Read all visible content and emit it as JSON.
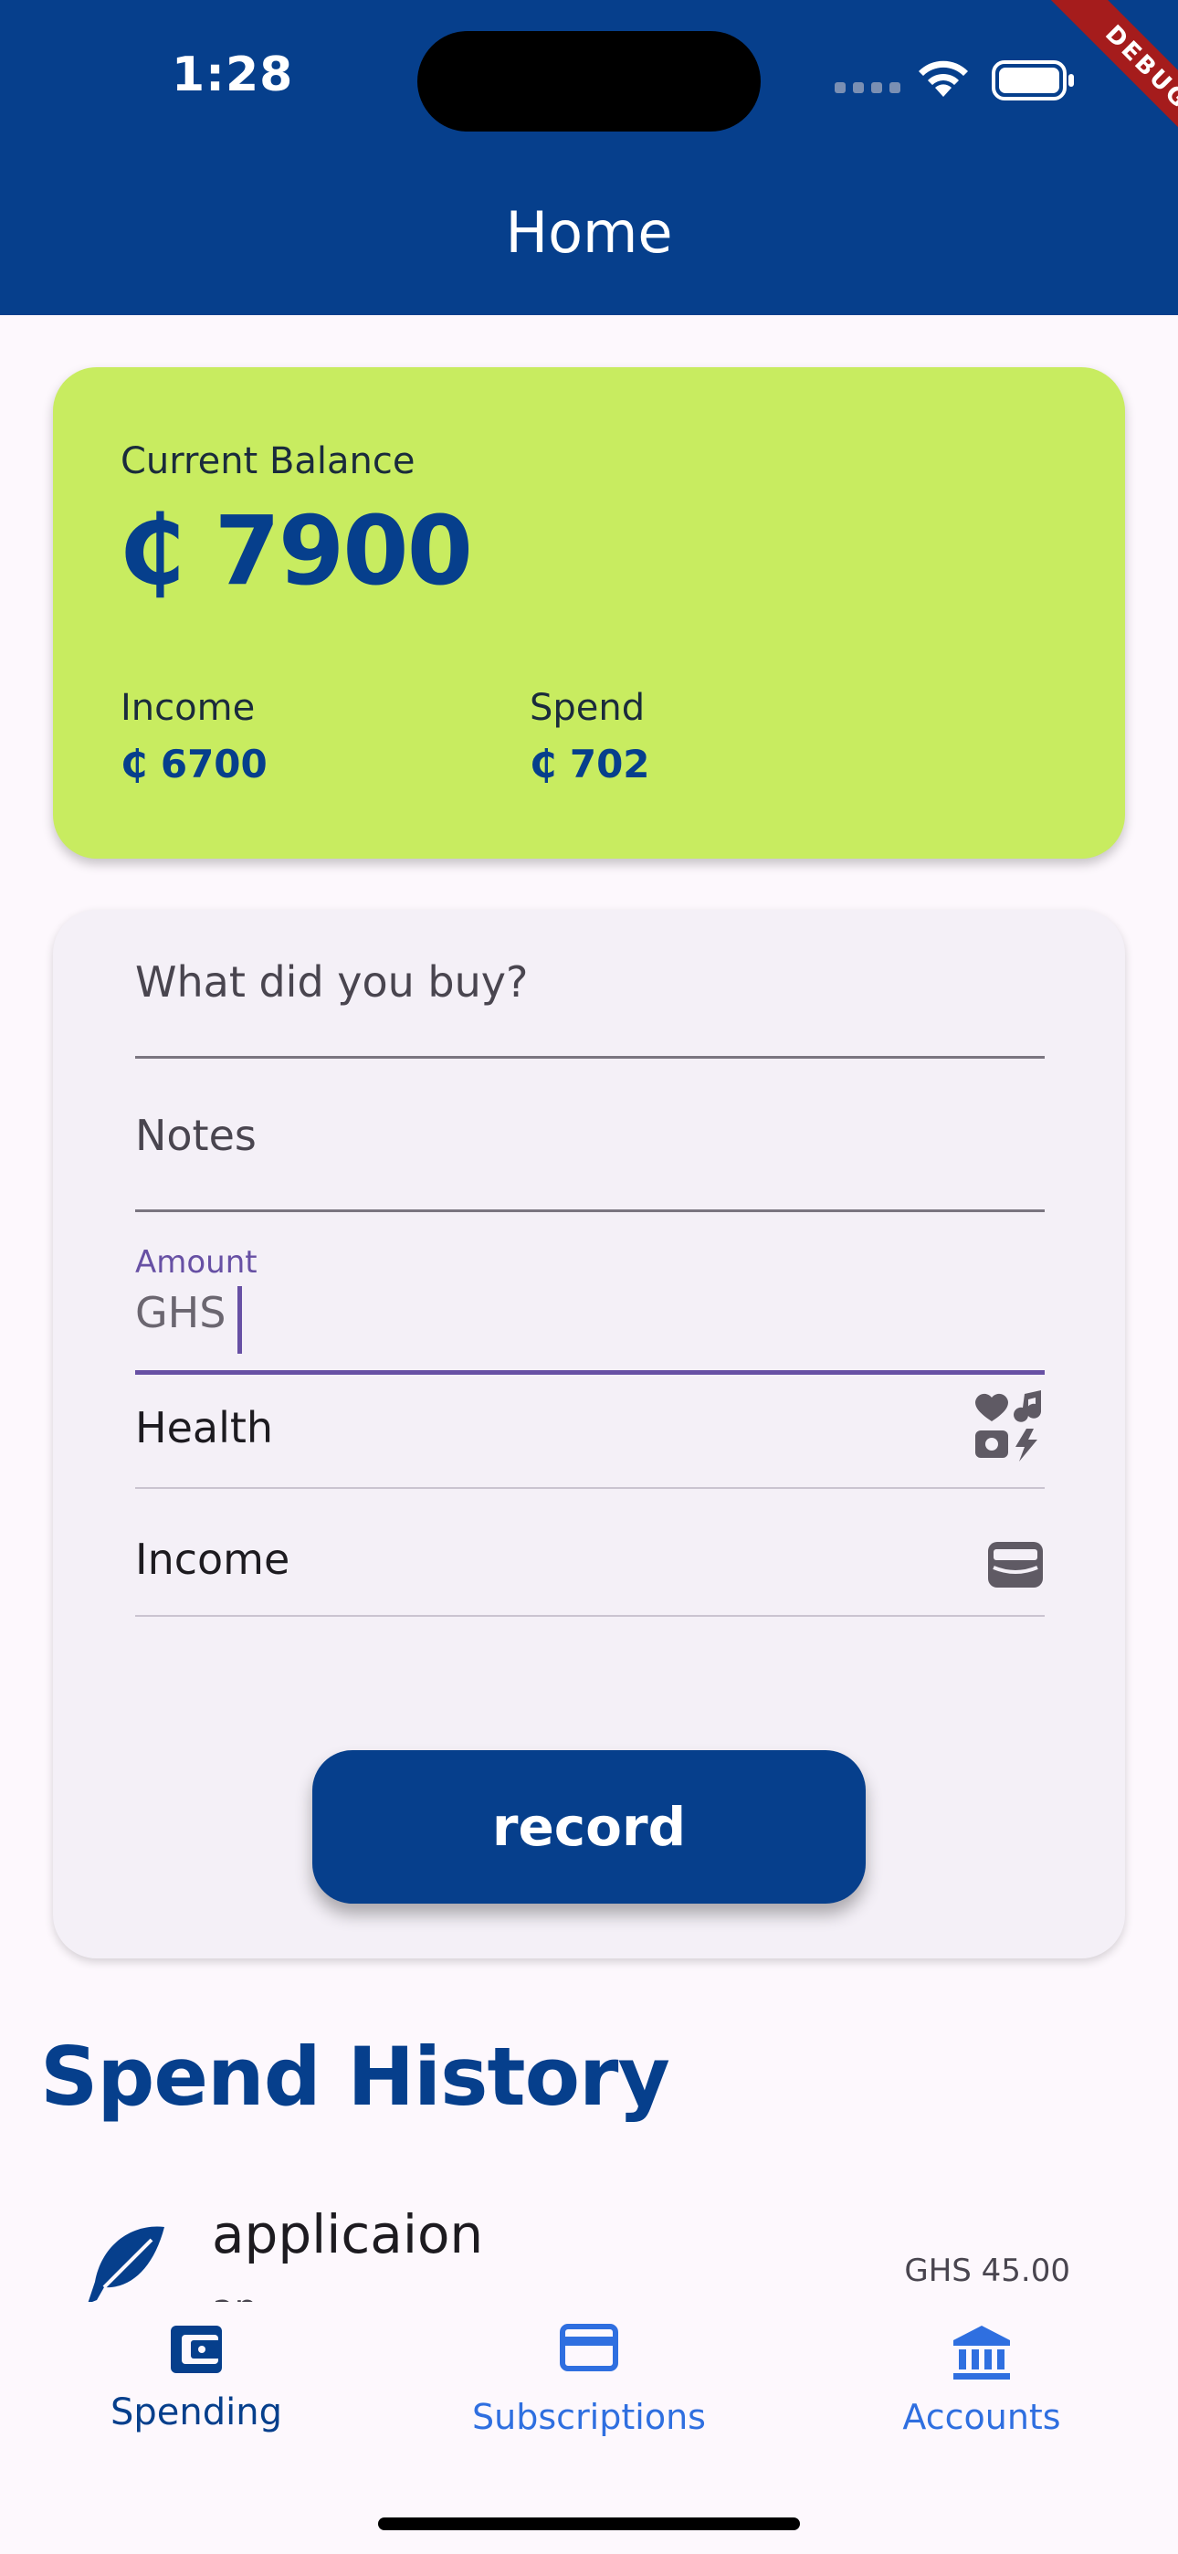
{
  "status_bar": {
    "time": "1:28",
    "debug_label": "DEBUG"
  },
  "appbar": {
    "title": "Home"
  },
  "balance_card": {
    "label": "Current Balance",
    "value": "₵ 7900",
    "income_label": "Income",
    "income_value": "₵ 6700",
    "spend_label": "Spend",
    "spend_value": "₵ 702"
  },
  "form": {
    "purchase_placeholder": "What did you buy?",
    "notes_placeholder": "Notes",
    "amount_label": "Amount",
    "amount_prefix": "GHS",
    "category_value": "Health",
    "category_icon": "interests-icon",
    "type_value": "Income",
    "type_icon": "wallet-icon",
    "record_label": "record"
  },
  "history": {
    "title": "Spend History",
    "items": [
      {
        "title": "applicaion",
        "subtitle": "ap",
        "amount": "GHS 45.00",
        "icon": "feather-icon"
      }
    ]
  },
  "bottom_nav": {
    "items": [
      {
        "label": "Spending",
        "icon": "wallet-icon",
        "selected": true
      },
      {
        "label": "Subscriptions",
        "icon": "credit-card-icon",
        "selected": false
      },
      {
        "label": "Accounts",
        "icon": "bank-icon",
        "selected": false
      }
    ]
  },
  "colors": {
    "primary": "#063f8c",
    "balance_card": "#c8ec60",
    "accent": "#6750a4",
    "nav_inactive": "#2f6fe0",
    "debug_banner": "#a51c1c"
  }
}
